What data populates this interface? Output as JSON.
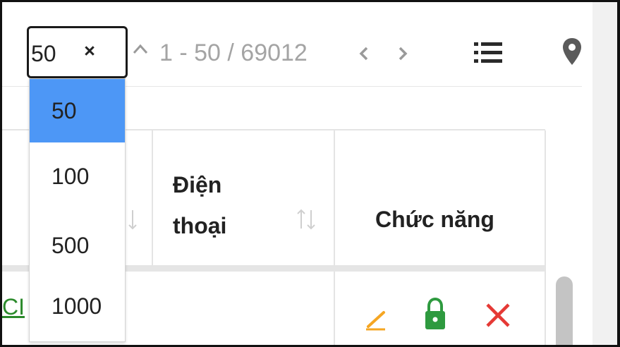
{
  "pagination": {
    "page_size_value": "50",
    "range_text": "1 - 50 / 69012",
    "page_size_options": [
      "50",
      "100",
      "500",
      "1000"
    ],
    "selected_option": "50"
  },
  "table": {
    "columns": [
      {
        "label": "Điện\nthoại",
        "sortable": true
      },
      {
        "label": "Chức năng",
        "sortable": false
      }
    ],
    "first_row": {
      "partial_link_text": "CI"
    },
    "row_actions": [
      "pencil-icon",
      "lock-icon",
      "delete-x-icon"
    ]
  },
  "colors": {
    "selected_option_bg": "#4d97f6",
    "edit_icon": "#f5a623",
    "lock_icon": "#2e9a3f",
    "delete_icon": "#e53935",
    "link_text": "#2b8a2b"
  }
}
